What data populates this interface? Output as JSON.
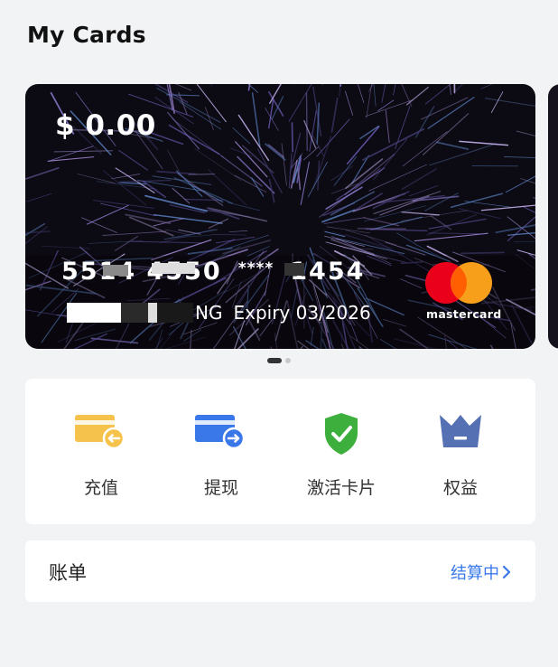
{
  "page": {
    "title": "My Cards"
  },
  "card": {
    "balance": "$ 0.00",
    "number_visible_start": "5514 4550",
    "number_masked": "****",
    "number_last": "1454",
    "holder_suffix": "NG",
    "expiry": "Expiry 03/2026",
    "brand": "mastercard",
    "brand_colors": {
      "red": "#EB001B",
      "yellow": "#F79E1B",
      "overlap": "#FF5F00"
    }
  },
  "carousel": {
    "pages": 2,
    "active_index": 0
  },
  "actions": [
    {
      "label": "充值",
      "icon": "top-up-card-icon",
      "color": "#F5C24C"
    },
    {
      "label": "提现",
      "icon": "withdraw-card-icon",
      "color": "#3A78EA"
    },
    {
      "label": "激活卡片",
      "icon": "shield-check-icon",
      "color": "#3DAF3D"
    },
    {
      "label": "权益",
      "icon": "crown-icon",
      "color": "#5670B4"
    }
  ],
  "bill": {
    "title": "账单",
    "status": "结算中",
    "status_color": "#3A78EA"
  }
}
